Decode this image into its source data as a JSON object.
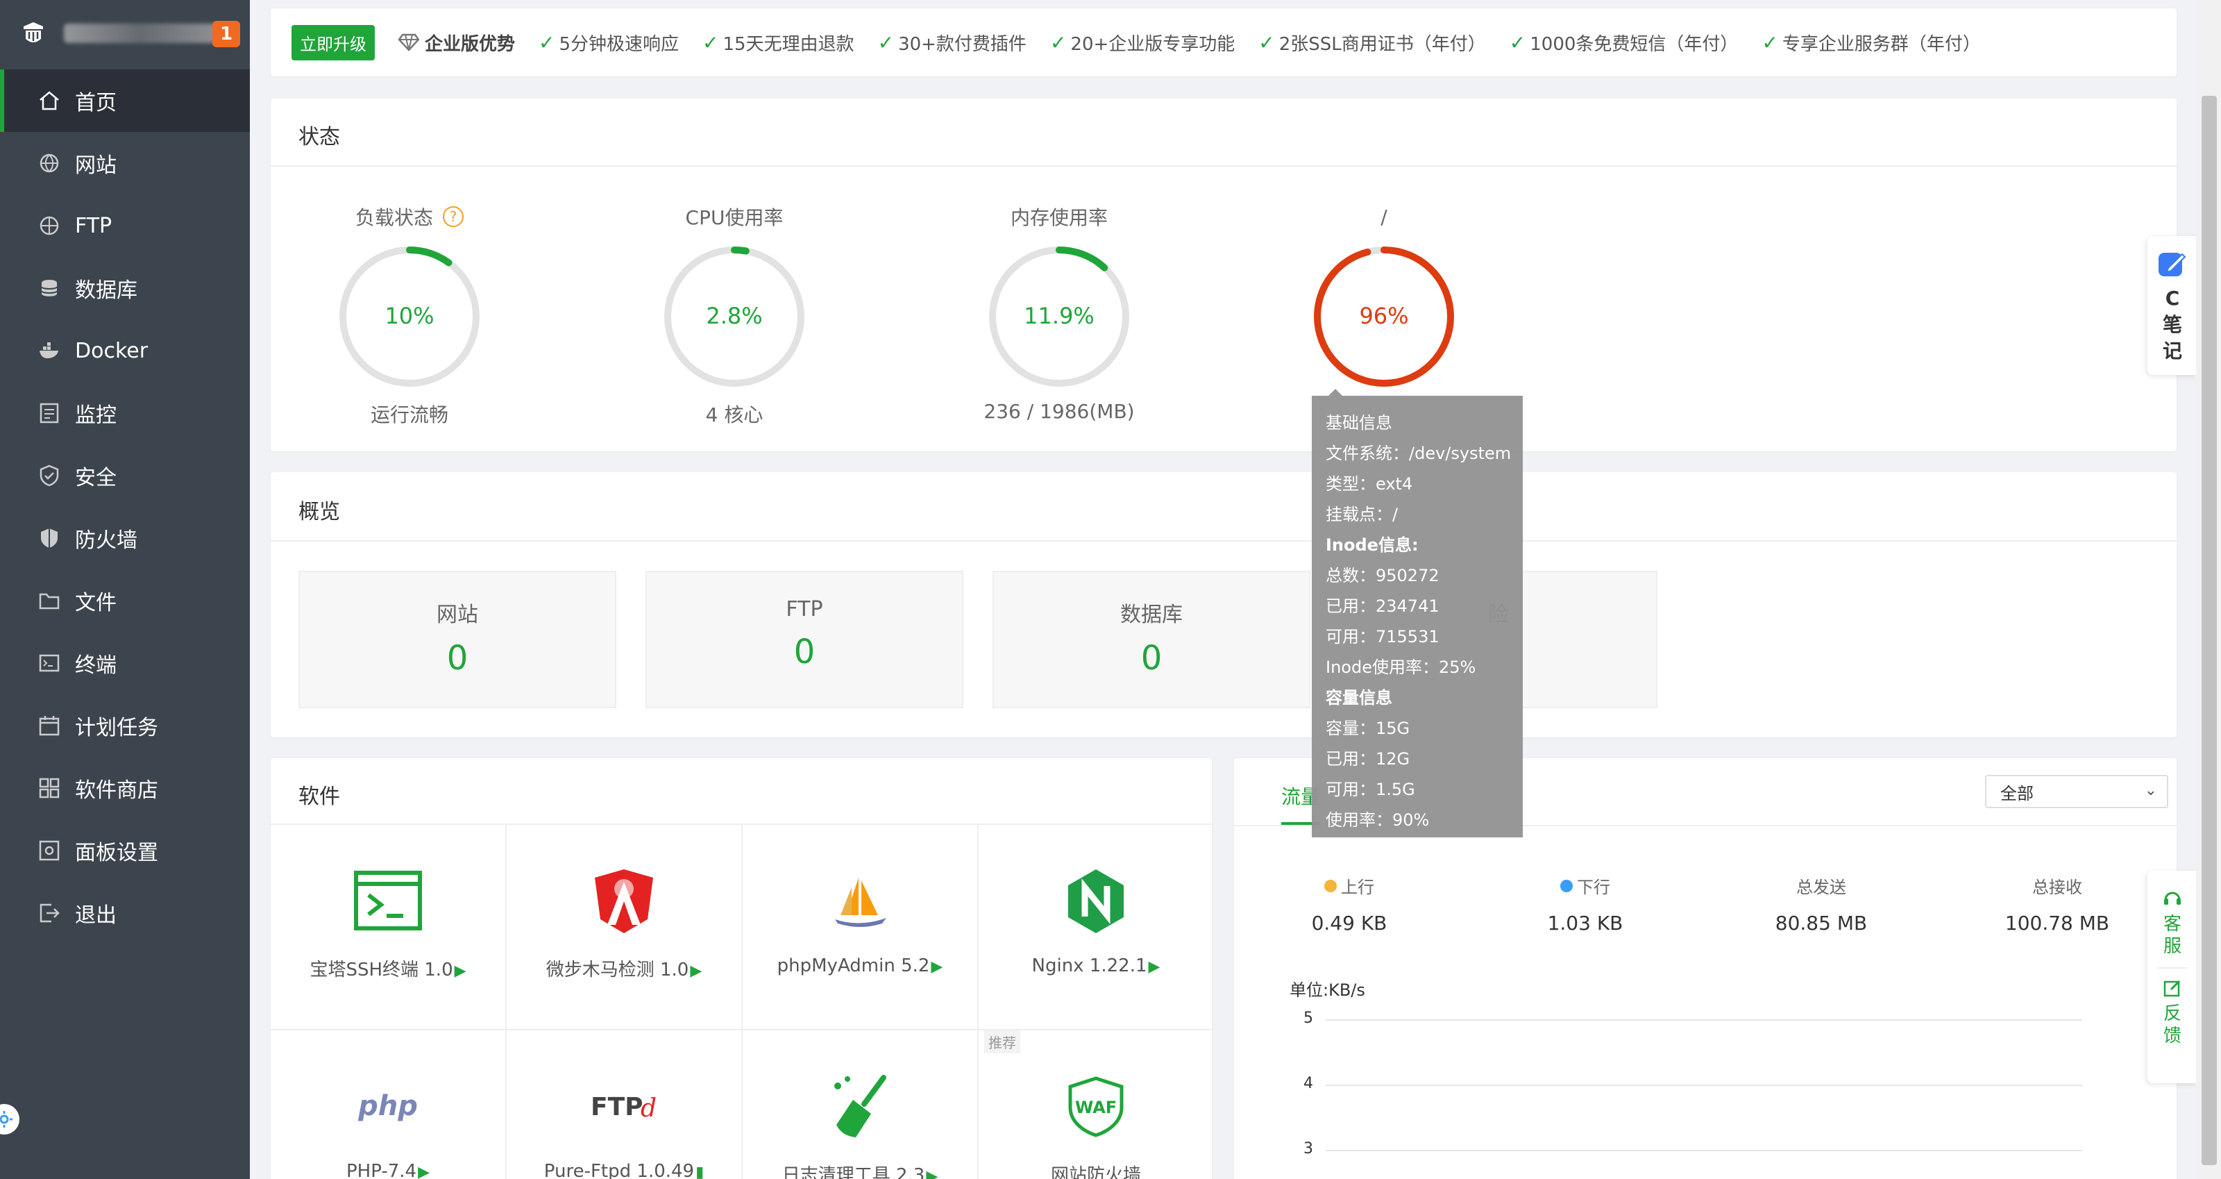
{
  "sidebar": {
    "badge": "1",
    "items": [
      {
        "label": "首页",
        "icon": "home-icon"
      },
      {
        "label": "网站",
        "icon": "globe-icon"
      },
      {
        "label": "FTP",
        "icon": "ftp-icon"
      },
      {
        "label": "数据库",
        "icon": "database-icon"
      },
      {
        "label": "Docker",
        "icon": "docker-icon"
      },
      {
        "label": "监控",
        "icon": "monitor-icon"
      },
      {
        "label": "安全",
        "icon": "shield-check-icon"
      },
      {
        "label": "防火墙",
        "icon": "firewall-icon"
      },
      {
        "label": "文件",
        "icon": "folder-icon"
      },
      {
        "label": "终端",
        "icon": "terminal-icon"
      },
      {
        "label": "计划任务",
        "icon": "calendar-icon"
      },
      {
        "label": "软件商店",
        "icon": "apps-icon"
      },
      {
        "label": "面板设置",
        "icon": "settings-icon"
      },
      {
        "label": "退出",
        "icon": "logout-icon"
      }
    ]
  },
  "upgrade": {
    "button": "立即升级",
    "title": "企业版优势",
    "features": [
      "5分钟极速响应",
      "15天无理由退款",
      "30+款付费插件",
      "20+企业版专享功能",
      "2张SSL商用证书（年付）",
      "1000条免费短信（年付）",
      "专享企业服务群（年付）"
    ]
  },
  "status": {
    "title": "状态",
    "gauges": [
      {
        "title": "负载状态",
        "value": "10%",
        "percent": 10,
        "sub": "运行流畅",
        "color": "#20a53a",
        "help": "?"
      },
      {
        "title": "CPU使用率",
        "value": "2.8%",
        "percent": 2.8,
        "sub": "4 核心",
        "color": "#20a53a"
      },
      {
        "title": "内存使用率",
        "value": "11.9%",
        "percent": 11.9,
        "sub": "236 / 1986(MB)",
        "color": "#20a53a"
      },
      {
        "title": "/",
        "value": "96%",
        "percent": 96,
        "sub": "",
        "color": "#dd3c11"
      }
    ],
    "tooltip": [
      {
        "text": "基础信息",
        "bold": false
      },
      {
        "text": "文件系统：/dev/system",
        "bold": false
      },
      {
        "text": "类型：ext4",
        "bold": false
      },
      {
        "text": "挂载点：/",
        "bold": false
      },
      {
        "text": "Inode信息:",
        "bold": true
      },
      {
        "text": "总数：950272",
        "bold": false
      },
      {
        "text": "已用：234741",
        "bold": false
      },
      {
        "text": "可用：715531",
        "bold": false
      },
      {
        "text": "Inode使用率：25%",
        "bold": false
      },
      {
        "text": "容量信息",
        "bold": true
      },
      {
        "text": "容量：15G",
        "bold": false
      },
      {
        "text": "已用：12G",
        "bold": false
      },
      {
        "text": "可用：1.5G",
        "bold": false
      },
      {
        "text": "使用率：90%",
        "bold": false
      }
    ]
  },
  "overview": {
    "title": "概览",
    "boxes": [
      {
        "label": "网站",
        "value": "0"
      },
      {
        "label": "FTP",
        "value": "0"
      },
      {
        "label": "数据库",
        "value": "0"
      },
      {
        "label": "险",
        "value": ""
      }
    ]
  },
  "software": {
    "title": "软件",
    "items": [
      {
        "name": "宝塔SSH终端 1.0",
        "icon": "ssh-terminal-icon",
        "arrow": "▶"
      },
      {
        "name": "微步木马检测 1.0",
        "icon": "trojan-detect-icon",
        "arrow": "▶"
      },
      {
        "name": "phpMyAdmin 5.2",
        "icon": "phpmyadmin-icon",
        "arrow": "▶"
      },
      {
        "name": "Nginx 1.22.1",
        "icon": "nginx-icon",
        "arrow": "▶"
      },
      {
        "name": "PHP-7.4",
        "icon": "php-icon",
        "arrow": "▶"
      },
      {
        "name": "Pure-Ftpd 1.0.49",
        "icon": "ftpd-icon",
        "arrow": "▮"
      },
      {
        "name": "日志清理工具 2.3",
        "icon": "log-clean-icon",
        "arrow": "▶"
      },
      {
        "name": "网站防火墙",
        "icon": "waf-icon",
        "arrow": "",
        "tag": "推荐"
      }
    ]
  },
  "traffic": {
    "tab": "流量",
    "select": "全部",
    "stats": [
      {
        "label": "上行",
        "value": "0.49 KB",
        "color": "#f5b53a"
      },
      {
        "label": "下行",
        "value": "1.03 KB",
        "color": "#3a9cf5"
      },
      {
        "label": "总发送",
        "value": "80.85 MB"
      },
      {
        "label": "总接收",
        "value": "100.78 MB"
      }
    ],
    "unit": "单位:KB/s",
    "yticks": [
      "5",
      "4",
      "3"
    ]
  },
  "float_note": {
    "letter": "C",
    "l1": "笔",
    "l2": "记"
  },
  "float_service": {
    "kf1": "客",
    "kf2": "服",
    "fk1": "反",
    "fk2": "馈"
  }
}
